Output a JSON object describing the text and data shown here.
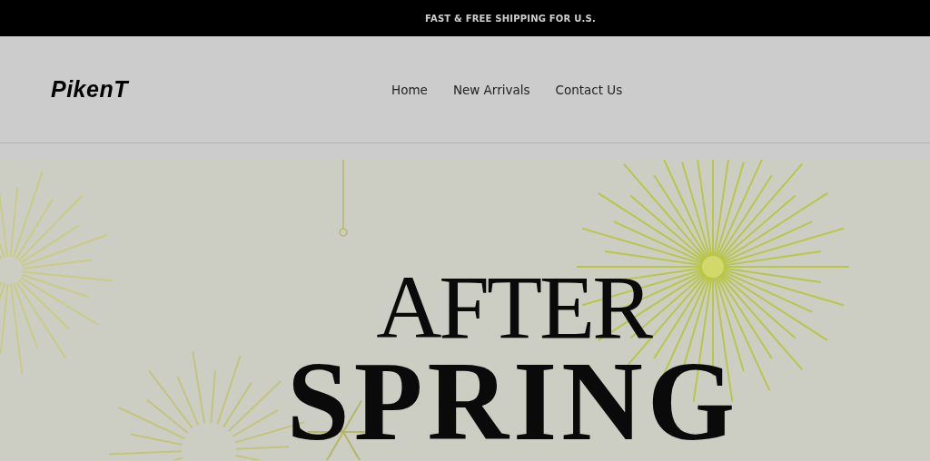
{
  "announcement": {
    "text": "FAST & FREE SHIPPING FOR U.S."
  },
  "header": {
    "logo": "PikenT",
    "nav": [
      {
        "label": "Home"
      },
      {
        "label": "New Arrivals"
      },
      {
        "label": "Contact Us"
      }
    ]
  },
  "hero": {
    "kind": "picture",
    "lines": [
      {
        "text": "AFTER",
        "kind": "light"
      },
      {
        "text": "SPRING",
        "kind": "bold"
      }
    ]
  }
}
